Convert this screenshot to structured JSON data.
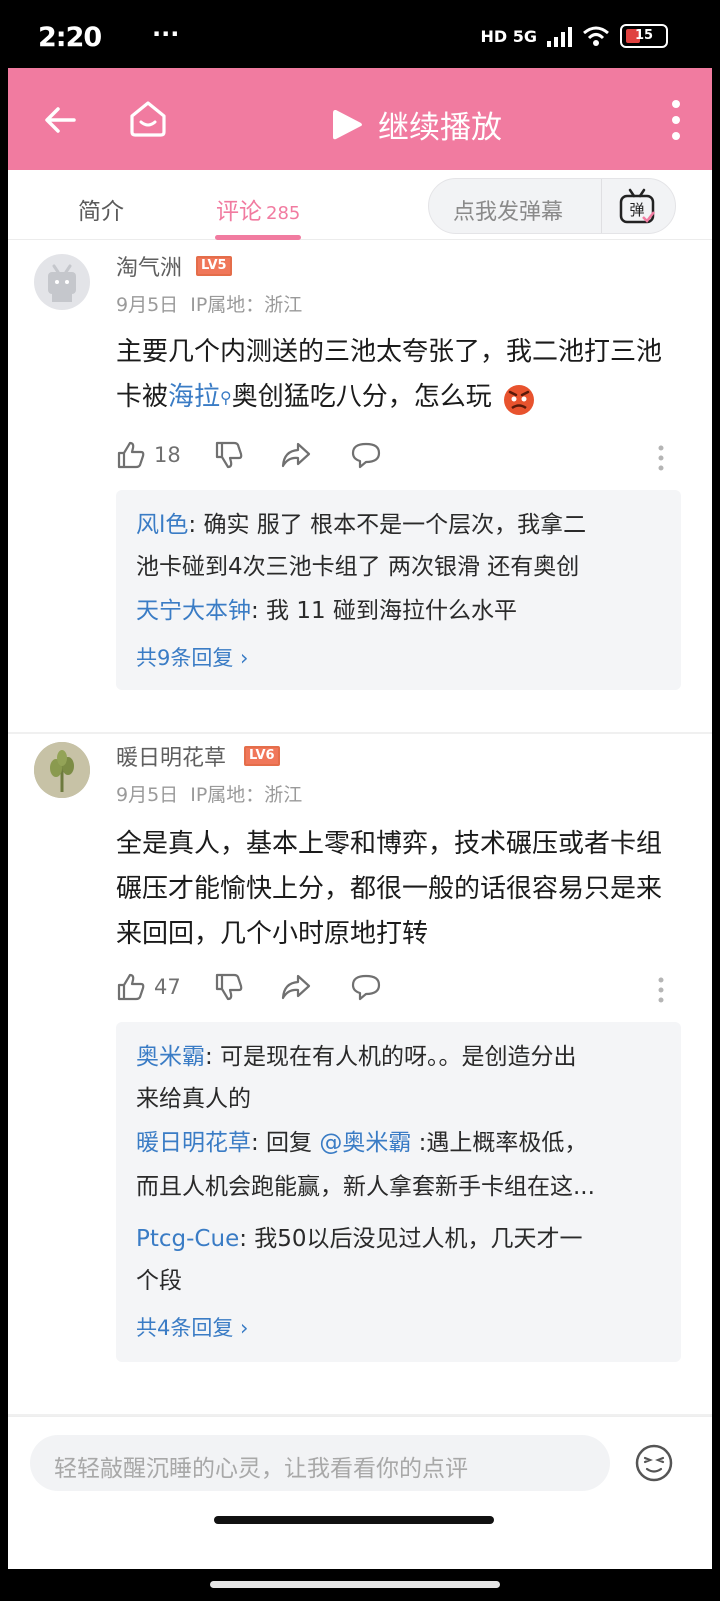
{
  "status_bar": {
    "time": "2:20",
    "overflow": "···",
    "network": "HD 5G",
    "battery": "15"
  },
  "top_bar": {
    "play_label": "继续播放"
  },
  "tabs": [
    {
      "label": "简介"
    },
    {
      "label": "评论",
      "count": "285"
    }
  ],
  "danmu": {
    "placeholder": "点我发弹幕",
    "icon_label": "弹"
  },
  "comments": [
    {
      "user": "淘气洲",
      "level": "LV5",
      "date": "9月5日",
      "ip": "IP属地：浙江",
      "body_pre": "主要几个内测送的三池太夸张了，我二池打三池卡被",
      "link": "海拉",
      "body_post": "奥创猛吃八分，怎么玩",
      "likes": "18",
      "replies": [
        {
          "name": "风l色",
          "text": ": 确实 服了 根本不是一个层次，我拿二"
        },
        {
          "name": "",
          "text": "池卡碰到4次三池卡组了 两次银滑 还有奥创"
        },
        {
          "name": "天宁大本钟",
          "text": ": 我 11 碰到海拉什么水平"
        }
      ],
      "more_replies": "共9条回复 ›"
    },
    {
      "user": "暖日明花草",
      "level": "LV6",
      "date": "9月5日",
      "ip": "IP属地：浙江",
      "body": "全是真人，基本上零和博弈，技术碾压或者卡组碾压才能愉快上分，都很一般的话很容易只是来来回回，几个小时原地打转",
      "likes": "47",
      "replies": [
        {
          "name": "奥米霸",
          "text": ": 可是现在有人机的呀。。是创造分出"
        },
        {
          "name": "",
          "text": "来给真人的"
        },
        {
          "name": "暖日明花草",
          "text": ": 回复 ",
          "mention": "@奥米霸",
          "tail": " :遇上概率极低，"
        },
        {
          "name": "",
          "text": "而且人机会跑能赢，新人拿套新手卡组在这..."
        },
        {
          "name": "Ptcg-Cue",
          "text": ": 我50以后没见过人机，几天才一"
        },
        {
          "name": "",
          "text": "个段"
        }
      ],
      "more_replies": "共4条回复 ›"
    }
  ],
  "input": {
    "placeholder": "轻轻敲醒沉睡的心灵，让我看看你的点评"
  },
  "colors": {
    "accent": "#f17ba0",
    "link": "#3a7cc5",
    "level_badge": "#f0775a"
  },
  "icons": [
    "back-arrow-icon",
    "home-icon",
    "play-icon",
    "more-vertical-icon",
    "danmu-icon",
    "like-icon",
    "dislike-icon",
    "share-icon",
    "reply-icon",
    "emoji-icon"
  ]
}
